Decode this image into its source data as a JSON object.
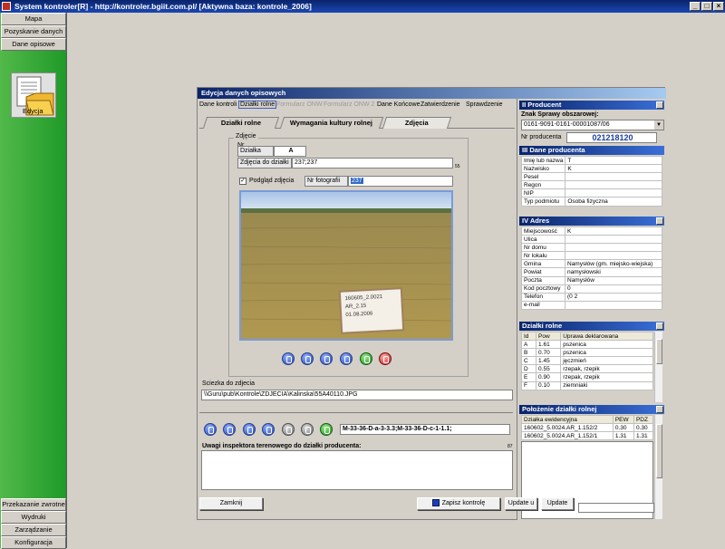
{
  "window": {
    "title": "System kontroler[R] - http://kontroler.bgiit.com.pl/ [Aktywna baza: kontrole_2006]",
    "btn_min": "_",
    "btn_max": "□",
    "btn_close": "×"
  },
  "sidebar": {
    "top_items": [
      "Mapa",
      "Pozyskanie danych",
      "Dane opisowe"
    ],
    "edit_label": "Edycja",
    "bottom_items": [
      "Przekazanie zwrotne",
      "Wydruki",
      "Zarządzanie",
      "Konfiguracja"
    ]
  },
  "dialog": {
    "title": "Edycja danych opisowych",
    "menu": [
      "Dane kontroli",
      "Działki rolne",
      "Formularz ONW",
      "Formularz ONW 2",
      "Dane Końcowe",
      "Zatwierdzenie",
      "Sprawdzenie"
    ],
    "tabs": [
      "Działki rolne",
      "Wymagania kultury rolnej",
      "Zdjęcia"
    ],
    "photo": {
      "group_label": "Zdjęcie",
      "nr_label": "Nr",
      "dzialka_label": "Działka",
      "dzialka_value": "A",
      "zdjecia_label": "Zdjęcia do działki",
      "zdjecia_value": "237;237",
      "side_mark": "55",
      "preview_label": "Podgląd zdjęcia",
      "nr_foto_label": "Nr fotografii",
      "nr_foto_value": "237",
      "sign_lines": [
        "160605_2.0021",
        "AR_2.15",
        "01.08.2006"
      ],
      "path_label": "Sciezka do zdjecia",
      "path_value": "\\\\Guru\\pub\\Kontrole\\ZDJECIA\\Kalinska\\55A40110.JPG"
    },
    "coords_value": "M-33-36-D-a-3-3.3;M-33-36-D-c-1-1.1;",
    "uwagi_label": "Uwagi inspektora terenowego do działki producenta:",
    "uwagi_counter": "87",
    "buttons": {
      "close": "Zamknij",
      "save": "Zapisz kontrolę",
      "update_u": "Update u",
      "update": "Update"
    }
  },
  "producer": {
    "header": "II Producent",
    "znak_label": "Znak Sprawy obszarowej:",
    "znak_value": "0161-9091-0161-00001087/06",
    "nr_label": "Nr producenta",
    "nr_value": "021218120",
    "dane_header": "III Dane producenta",
    "dane_rows": [
      {
        "label": "Imię lub nazwa",
        "value": "T"
      },
      {
        "label": "Nazwisko",
        "value": "K"
      },
      {
        "label": "Pesel",
        "value": ""
      },
      {
        "label": "Regon",
        "value": ""
      },
      {
        "label": "NIP",
        "value": ""
      },
      {
        "label": "Typ podmiotu",
        "value": "Osoba fizyczna"
      }
    ],
    "adres_header": "IV Adres",
    "adres_rows": [
      {
        "label": "Miejscowość",
        "value": "K"
      },
      {
        "label": "Ulica",
        "value": ""
      },
      {
        "label": "Nr domu",
        "value": ""
      },
      {
        "label": "Nr lokalu",
        "value": ""
      },
      {
        "label": "Gmina",
        "value": "Namysłów (gm. miejsko-wiejska)"
      },
      {
        "label": "Powiat",
        "value": "namysłowski"
      },
      {
        "label": "Poczta",
        "value": "Namysłów"
      },
      {
        "label": "Kod pocztowy",
        "value": "0"
      },
      {
        "label": "Telefon",
        "value": "(0                2"
      },
      {
        "label": "e-mail",
        "value": ""
      }
    ],
    "dzialki_header": "Działki rolne",
    "dzialki_cols": [
      "Id",
      "Pow",
      "Uprawa deklarowana"
    ],
    "dzialki_rows": [
      [
        "A",
        "1.61",
        "pszenica"
      ],
      [
        "B",
        "0.70",
        "pszenica"
      ],
      [
        "C",
        "1.45",
        "jęczmień"
      ],
      [
        "D",
        "0.55",
        "rzepak, rzepik"
      ],
      [
        "E",
        "0.90",
        "rzepak, rzepik"
      ],
      [
        "F",
        "0.10",
        "ziemniaki"
      ]
    ],
    "polozenie_header": "Położenie działki rolnej",
    "polozenie_cols": [
      "Działka ewidencyjna",
      "PEW",
      "PDZ"
    ],
    "polozenie_rows": [
      [
        "160602_5.0024.AR_1.152/2",
        "0.30",
        "0.30"
      ],
      [
        "160602_5.0024.AR_1.152/1",
        "1.31",
        "1.31"
      ]
    ]
  }
}
